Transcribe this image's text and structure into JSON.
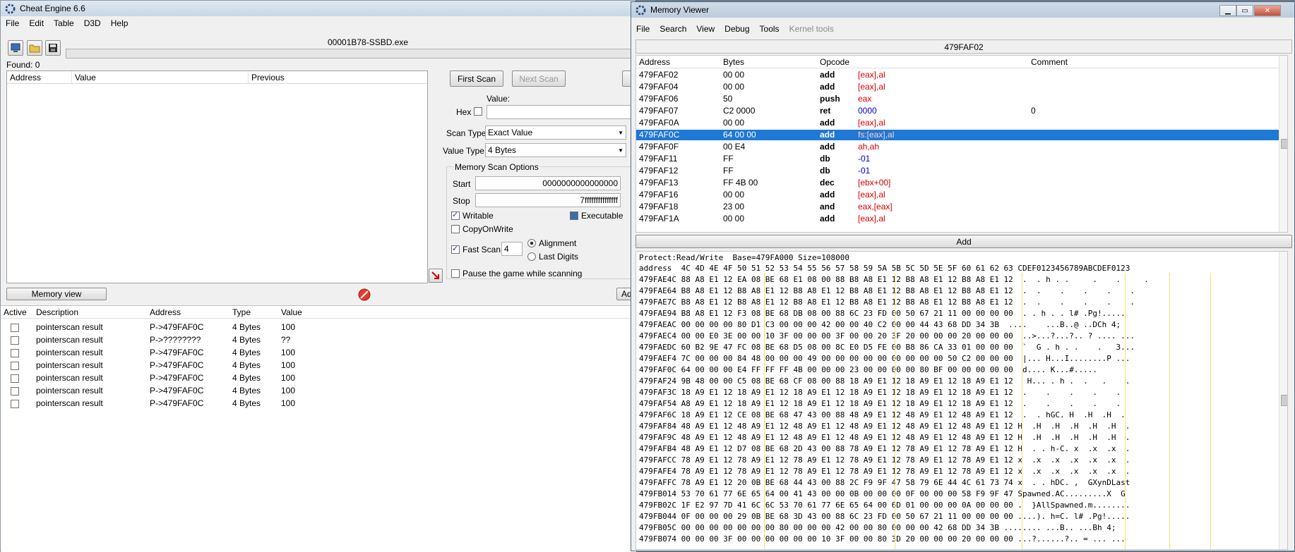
{
  "ce": {
    "title": "Cheat Engine 6.6",
    "menu": [
      "File",
      "Edit",
      "Table",
      "D3D",
      "Help"
    ],
    "process": "00001B78-SSBD.exe",
    "found": "Found: 0",
    "results_headers": [
      "Address",
      "Value",
      "Previous"
    ],
    "first_scan": "First Scan",
    "next_scan": "Next Scan",
    "value_label": "Value:",
    "hex_label": "Hex",
    "scan_type_label": "Scan Type",
    "scan_type": "Exact Value",
    "value_type_label": "Value Type",
    "value_type": "4 Bytes",
    "options_title": "Memory Scan Options",
    "start_label": "Start",
    "start_value": "0000000000000000",
    "stop_label": "Stop",
    "stop_value": "7fffffffffffffff",
    "writable": "Writable",
    "executable": "Executable",
    "copyonwrite": "CopyOnWrite",
    "fast_scan": "Fast Scan",
    "fast_scan_value": "4",
    "alignment": "Alignment",
    "last_digits": "Last Digits",
    "pause_game": "Pause the game while scanning",
    "memory_view": "Memory view",
    "add_partial": "Ad",
    "table_headers": [
      "Active",
      "Description",
      "Address",
      "Type",
      "Value"
    ],
    "table_rows": [
      {
        "desc": "pointerscan result",
        "addr": "P->479FAF0C",
        "type": "4 Bytes",
        "value": "100"
      },
      {
        "desc": "pointerscan result",
        "addr": "P->????????",
        "type": "4 Bytes",
        "value": "??"
      },
      {
        "desc": "pointerscan result",
        "addr": "P->479FAF0C",
        "type": "4 Bytes",
        "value": "100"
      },
      {
        "desc": "pointerscan result",
        "addr": "P->479FAF0C",
        "type": "4 Bytes",
        "value": "100"
      },
      {
        "desc": "pointerscan result",
        "addr": "P->479FAF0C",
        "type": "4 Bytes",
        "value": "100"
      },
      {
        "desc": "pointerscan result",
        "addr": "P->479FAF0C",
        "type": "4 Bytes",
        "value": "100"
      },
      {
        "desc": "pointerscan result",
        "addr": "P->479FAF0C",
        "type": "4 Bytes",
        "value": "100"
      }
    ]
  },
  "mv": {
    "title": "Memory Viewer",
    "menu": [
      "File",
      "Search",
      "View",
      "Debug",
      "Tools"
    ],
    "menu_disabled": "Kernel tools",
    "address_bar": "479FAF02",
    "headers": [
      "Address",
      "Bytes",
      "Opcode",
      "Comment"
    ],
    "rows": [
      {
        "addr": "479FAF02",
        "bytes": "00 00",
        "op": "add",
        "args": "[eax],al",
        "comment": ""
      },
      {
        "addr": "479FAF04",
        "bytes": "00 00",
        "op": "add",
        "args": "[eax],al",
        "comment": ""
      },
      {
        "addr": "479FAF06",
        "bytes": "50",
        "op": "push",
        "args": "eax",
        "comment": ""
      },
      {
        "addr": "479FAF07",
        "bytes": "C2 0000",
        "op": "ret",
        "args": "0000",
        "comment": "0"
      },
      {
        "addr": "479FAF0A",
        "bytes": "00 00",
        "op": "add",
        "args": "[eax],al",
        "comment": ""
      },
      {
        "addr": "479FAF0C",
        "bytes": "64 00 00",
        "op": "add",
        "args": "fs:[eax],al",
        "comment": ""
      },
      {
        "addr": "479FAF0F",
        "bytes": "00 E4",
        "op": "add",
        "args": "ah,ah",
        "comment": ""
      },
      {
        "addr": "479FAF11",
        "bytes": "FF",
        "op": "db",
        "args": "-01",
        "comment": ""
      },
      {
        "addr": "479FAF12",
        "bytes": "FF",
        "op": "db",
        "args": "-01",
        "comment": ""
      },
      {
        "addr": "479FAF13",
        "bytes": "FF 4B 00",
        "op": "dec",
        "args": "[ebx+00]",
        "comment": ""
      },
      {
        "addr": "479FAF16",
        "bytes": "00 00",
        "op": "add",
        "args": "[eax],al",
        "comment": ""
      },
      {
        "addr": "479FAF18",
        "bytes": "23 00",
        "op": "and",
        "args": "eax,[eax]",
        "comment": ""
      },
      {
        "addr": "479FAF1A",
        "bytes": "00 00",
        "op": "add",
        "args": "[eax],al",
        "comment": ""
      }
    ],
    "add_button": "Add",
    "protect_line": "Protect:Read/Write  Base=479FA000 Size=108000",
    "hex_header": "address  4C 4D 4E 4F 50 51 52 53 54 55 56 57 58 59 5A 5B 5C 5D 5E 5F 60 61 62 63 CDEF0123456789ABCDEF0123",
    "hex_lines": [
      "479FAE4C 88 A8 E1 12 EA 08 BE 68 E1 08 00 88 B8 A8 E1 12 B8 A8 E1 12 B8 A8 E1 12  .  . h . .     .    .     .",
      "479FAE64 B8 A8 E1 12 B8 A8 E1 12 B8 A8 E1 12 B8 A8 E1 12 B8 A8 E1 12 B8 A8 E1 12  .  .    .    .    .    .",
      "479FAE7C B8 A8 E1 12 B8 A8 E1 12 B8 A8 E1 12 B8 A8 E1 12 B8 A8 E1 12 B8 A8 E1 12  .  .    .    .    .    .",
      "479FAE94 B8 A8 E1 12 F3 08 BE 68 DB 08 00 88 6C 23 FD 00 50 67 21 11 00 00 00 00  . . h . . l# .Pg!.....",
      "479FAEAC 00 00 00 00 80 D1 C3 00 00 00 42 00 00 40 C2 00 00 44 43 68 DD 34 3B  ....    ...B..@ ..DCh 4;",
      "479FAEC4 00 00 E0 3E 00 00 10 3F 00 00 00 3F 00 00 20 3F 20 00 00 00 20 00 00 00  ..>...?...?.. ? .... ...",
      "479FAEDC 60 B2 9E 47 FC 08 BE 68 D5 08 00 8C E0 D5 FE 00 B8 86 CA 33 01 00 00 00  `  G . h . .    .   3...",
      "479FAEF4 7C 00 00 00 84 48 00 00 00 49 00 00 00 00 00 00 00 00 00 50 C2 00 00 00  |... H...I........P ...",
      "479FAF0C 64 00 00 00 E4 FF FF FF 4B 00 00 00 23 00 00 00 00 80 BF 00 00 00 00 00  d.... K...#.....",
      "479FAF24 9B 48 00 00 C5 08 BE 68 CF 08 00 88 18 A9 E1 12 18 A9 E1 12 18 A9 E1 12   H... . h .  .   .    .",
      "479FAF3C 18 A9 E1 12 18 A9 E1 12 18 A9 E1 12 18 A9 E1 12 18 A9 E1 12 18 A9 E1 12  .    .    .    .    .",
      "479FAF54 A8 A9 E1 12 18 A9 E1 12 18 A9 E1 12 18 A9 E1 12 18 A9 E1 12 18 A9 E1 12  .    .    .    .    .",
      "479FAF6C 18 A9 E1 12 CE 08 BE 68 47 43 00 88 48 A9 E1 12 48 A9 E1 12 48 A9 E1 12  .  . hGC. H  .H  .H  .",
      "479FAF84 48 A9 E1 12 48 A9 E1 12 48 A9 E1 12 48 A9 E1 12 48 A9 E1 12 48 A9 E1 12 H  .H  .H  .H  .H  .H  .",
      "479FAF9C 48 A9 E1 12 48 A9 E1 12 48 A9 E1 12 48 A9 E1 12 48 A9 E1 12 48 A9 E1 12 H  .H  .H  .H  .H  .H  .",
      "479FAFB4 48 A9 E1 12 D7 08 BE 68 2D 43 00 88 78 A9 E1 12 78 A9 E1 12 78 A9 E1 12 H  . . h-C. x  .x  .x  .",
      "479FAFCC 78 A9 E1 12 78 A9 E1 12 78 A9 E1 12 78 A9 E1 12 78 A9 E1 12 78 A9 E1 12 x  .x  .x  .x  .x  .x  .",
      "479FAFE4 78 A9 E1 12 78 A9 E1 12 78 A9 E1 12 78 A9 E1 12 78 A9 E1 12 78 A9 E1 12 x  .x  .x  .x  .x  .x  .",
      "479FAFFC 78 A9 E1 12 20 0B BE 68 44 43 00 88 2C F9 9F 47 58 79 6E 44 4C 61 73 74 x  . . hDC. ,  GXynDLast",
      "479FB014 53 70 61 77 6E 65 64 00 41 43 00 00 0B 00 00 00 0F 00 00 00 58 F9 9F 47 Spawned.AC.........X  G",
      "479FB02C 1F E2 97 7D 41 6C 6C 53 70 61 77 6E 65 64 00 6D 01 00 00 00 0A 00 00 00 .  }AllSpawned.m........",
      "479FB044 0F 00 00 00 29 0B BE 68 3D 43 00 88 6C 23 FD 00 50 67 21 11 00 00 00 00 ....). h=C. l# .Pg!.....",
      "479FB05C 00 00 00 00 00 00 00 80 00 00 00 42 00 00 80 00 00 00 42 68 DD 34 3B ........ ...B.. ...Bh 4;",
      "479FB074 00 00 00 3F 00 00 00 00 00 00 10 3F 00 00 80 3D 20 00 00 00 20 00 00 00 ...?......?.. = ... ..."
    ]
  },
  "colors": {
    "accent": "#3399ff",
    "selected_row": "#1e78d4",
    "register": "#d40000",
    "number": "#0000d4",
    "title_bg": "#cbd8e6"
  }
}
